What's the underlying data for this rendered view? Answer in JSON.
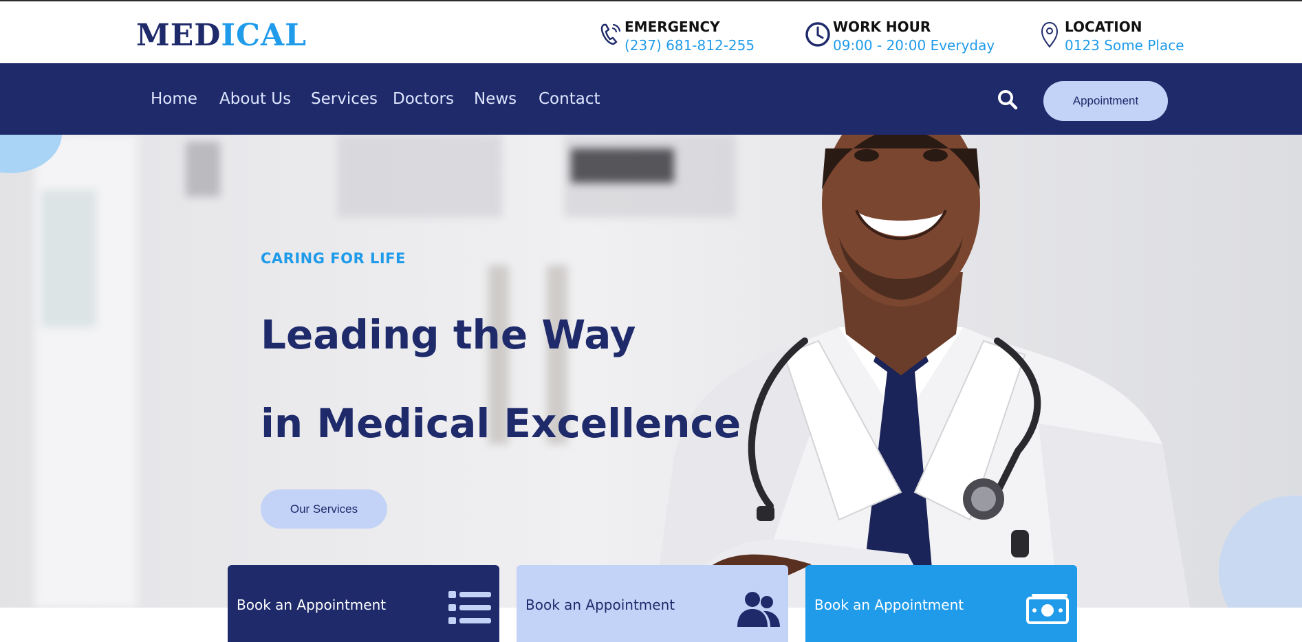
{
  "brand": {
    "logo_part1": "MED",
    "logo_part2": "ICAL"
  },
  "info": [
    {
      "label": "EMERGENCY",
      "value": "(237) 681-812-255",
      "icon": "phone-icon"
    },
    {
      "label": "WORK HOUR",
      "value": "09:00 - 20:00 Everyday",
      "icon": "clock-icon"
    },
    {
      "label": "LOCATION",
      "value": "0123 Some Place",
      "icon": "location-pin-icon"
    }
  ],
  "nav": {
    "links": [
      "Home",
      "About Us",
      "Services",
      "Doctors",
      "News",
      "Contact"
    ],
    "search_icon": "search-icon",
    "appointment_label": "Appointment"
  },
  "hero": {
    "eyebrow": "CARING FOR LIFE",
    "headline_line1": "Leading the Way",
    "headline_line2": "in Medical Excellence",
    "button_label": "Our Services"
  },
  "cards": [
    {
      "label": "Book an Appointment",
      "icon": "list-icon"
    },
    {
      "label": "Book an Appointment",
      "icon": "users-icon"
    },
    {
      "label": "Book an Appointment",
      "icon": "money-icon"
    }
  ],
  "colors": {
    "navy": "#1f2a6b",
    "accent_blue": "#1f9bea",
    "light_blue": "#c2d3f7",
    "white": "#ffffff"
  }
}
